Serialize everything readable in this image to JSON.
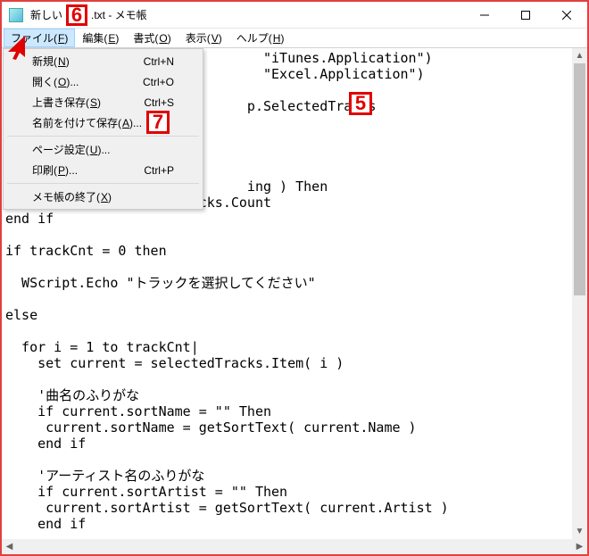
{
  "title_prefix": "新しい",
  "title_suffix": ".txt - メモ帳",
  "menubar": {
    "file": {
      "label": "ファイル",
      "mn": "F"
    },
    "edit": {
      "label": "編集",
      "mn": "E"
    },
    "format": {
      "label": "書式",
      "mn": "O"
    },
    "view": {
      "label": "表示",
      "mn": "V"
    },
    "help": {
      "label": "ヘルプ",
      "mn": "H"
    }
  },
  "file_menu": {
    "new": {
      "label": "新規",
      "mn": "N",
      "shortcut": "Ctrl+N"
    },
    "open": {
      "label": "開く",
      "mn": "O",
      "suffix": "...",
      "shortcut": "Ctrl+O"
    },
    "save": {
      "label": "上書き保存",
      "mn": "S",
      "shortcut": "Ctrl+S"
    },
    "saveas": {
      "label": "名前を付けて保存",
      "mn": "A",
      "suffix": "..."
    },
    "page": {
      "label": "ページ設定",
      "mn": "U",
      "suffix": "..."
    },
    "print": {
      "label": "印刷",
      "mn": "P",
      "suffix": "...",
      "shortcut": "Ctrl+P"
    },
    "exit": {
      "label": "メモ帳の終了",
      "mn": "X"
    }
  },
  "annotations": {
    "a5": "5",
    "a6": "6",
    "a7": "7"
  },
  "text": "                                \"iTunes.Application\")\n                                \"Excel.Application\")\n\n                              p.SelectedTracks\n\n\n\n\n                              ing ) Then\n  trackCnt = selectedTracks.Count\nend if\n\nif trackCnt = 0 then\n\n  WScript.Echo \"トラックを選択してください\"\n\nelse\n\n  for i = 1 to trackCnt|\n    set current = selectedTracks.Item( i )\n\n    '曲名のふりがな\n    if current.sortName = \"\" Then\n     current.sortName = getSortText( current.Name )\n    end if\n\n    'アーティスト名のふりがな\n    if current.sortArtist = \"\" Then\n     current.sortArtist = getSortText( current.Artist )\n    end if\n\n    'アルバムアーティスト名のふりがな\n    if current.sortAlbumArtist = \"\" Then"
}
